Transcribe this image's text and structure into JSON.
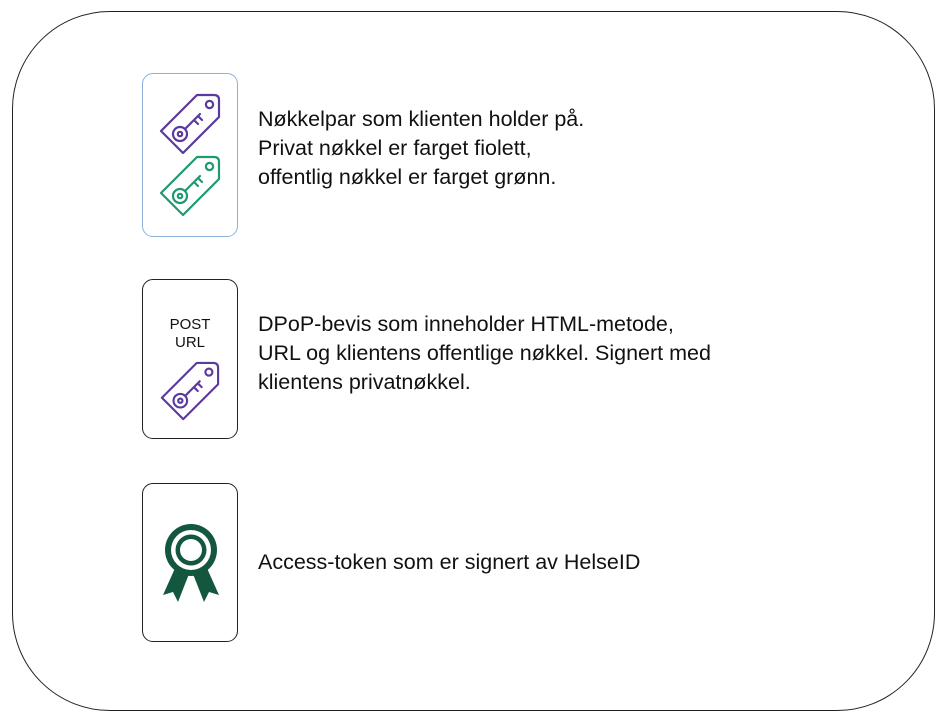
{
  "legend": {
    "items": [
      {
        "id": "key-pair",
        "icons": [
          "purple-key-tag-icon",
          "green-key-tag-icon"
        ],
        "lines": [
          "Nøkkelpar som klienten holder på.",
          "Privat nøkkel er farget fiolett,",
          "offentlig nøkkel er farget grønn."
        ]
      },
      {
        "id": "dpop-proof",
        "icons": [
          "purple-key-tag-icon"
        ],
        "card_lines": [
          "POST",
          "URL"
        ],
        "lines": [
          "DPoP-bevis som inneholder HTML-metode,",
          "URL og klientens offentlige nøkkel. Signert med",
          "klientens privatnøkkel."
        ]
      },
      {
        "id": "access-token",
        "icons": [
          "award-ribbon-icon"
        ],
        "lines": [
          "Access-token som er signert av HelseID"
        ]
      }
    ]
  },
  "colors": {
    "private_key": "#5b3a9e",
    "public_key": "#1f9a6e",
    "token": "#14573f",
    "card_highlight_border": "#8cb0dd",
    "border": "#222222"
  }
}
